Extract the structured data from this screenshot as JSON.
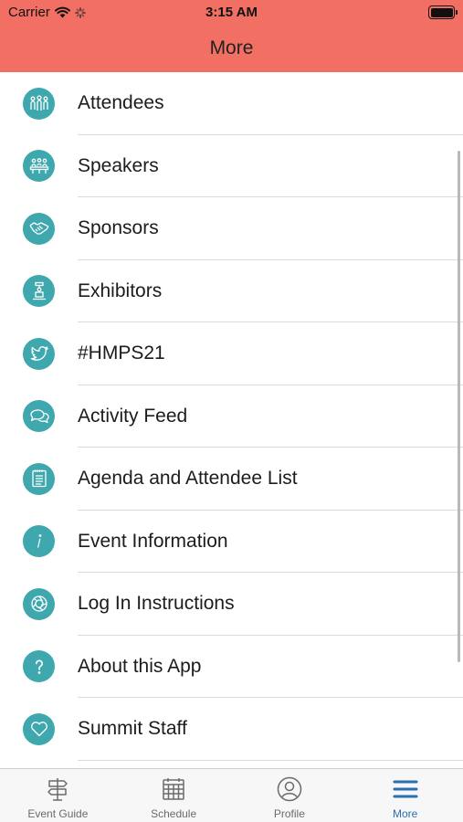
{
  "status_bar": {
    "carrier": "Carrier",
    "time": "3:15 AM"
  },
  "header": {
    "title": "More"
  },
  "menu": {
    "items": [
      {
        "label": "Attendees",
        "icon": "attendees-icon"
      },
      {
        "label": "Speakers",
        "icon": "speakers-icon"
      },
      {
        "label": "Sponsors",
        "icon": "handshake-icon"
      },
      {
        "label": "Exhibitors",
        "icon": "booth-icon"
      },
      {
        "label": "#HMPS21",
        "icon": "twitter-bird-icon"
      },
      {
        "label": "Activity Feed",
        "icon": "chat-bubbles-icon"
      },
      {
        "label": "Agenda and Attendee List",
        "icon": "notepad-icon"
      },
      {
        "label": "Event Information",
        "icon": "info-icon"
      },
      {
        "label": "Log In Instructions",
        "icon": "aperture-icon"
      },
      {
        "label": "About this App",
        "icon": "question-icon"
      },
      {
        "label": "Summit Staff",
        "icon": "heart-icon"
      }
    ]
  },
  "tabbar": {
    "tabs": [
      {
        "label": "Event Guide",
        "icon": "signpost-icon",
        "active": false
      },
      {
        "label": "Schedule",
        "icon": "calendar-icon",
        "active": false
      },
      {
        "label": "Profile",
        "icon": "profile-icon",
        "active": false
      },
      {
        "label": "More",
        "icon": "hamburger-menu-icon",
        "active": true
      }
    ]
  },
  "colors": {
    "header": "#f26f63",
    "icon_circle": "#3fa8ae",
    "tab_active": "#2a6fb0",
    "tab_inactive": "#6b6b6b"
  }
}
